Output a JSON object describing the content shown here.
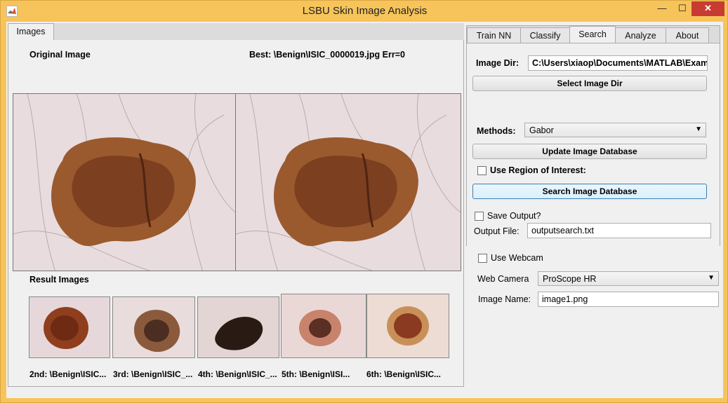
{
  "window": {
    "title": "LSBU Skin Image Analysis",
    "minimize": "—",
    "maximize": "☐",
    "close": "✕"
  },
  "left_tabs": [
    {
      "label": "Images",
      "active": true
    }
  ],
  "images_panel": {
    "original_label": "Original Image",
    "best_label": "Best: \\Benign\\ISIC_0000019.jpg Err=0",
    "result_label": "Result Images",
    "results": [
      {
        "label": "2nd: \\Benign\\ISIC..."
      },
      {
        "label": "3rd: \\Benign\\ISIC_..."
      },
      {
        "label": "4th: \\Benign\\ISIC_..."
      },
      {
        "label": "5th: \\Benign\\ISI..."
      },
      {
        "label": "6th: \\Benign\\ISIC..."
      }
    ]
  },
  "right_tabs": [
    {
      "label": "Train NN",
      "active": false
    },
    {
      "label": "Classify",
      "active": false
    },
    {
      "label": "Search",
      "active": true
    },
    {
      "label": "Analyze",
      "active": false
    },
    {
      "label": "About",
      "active": false
    }
  ],
  "search_panel": {
    "image_dir_label": "Image Dir:",
    "image_dir_value": "C:\\Users\\xiaop\\Documents\\MATLAB\\Examp",
    "select_dir_button": "Select Image Dir",
    "methods_label": "Methods:",
    "methods_value": "Gabor",
    "update_db_button": "Update Image Database",
    "roi_label": "Use Region of Interest:",
    "roi_checked": false,
    "search_db_button": "Search Image Database",
    "save_output_label": "Save Output?",
    "save_output_checked": false,
    "output_file_label": "Output File:",
    "output_file_value": "outputsearch.txt"
  },
  "webcam_panel": {
    "use_webcam_label": "Use Webcam",
    "use_webcam_checked": false,
    "web_camera_label": "Web Camera",
    "web_camera_value": "ProScope HR",
    "image_name_label": "Image Name:",
    "image_name_value": "image1.png"
  },
  "colors": {
    "title_bar": "#f6c45a",
    "close_button": "#c73b32",
    "lesion_brown": "#8a4a25",
    "skin": "#e9dde0"
  }
}
